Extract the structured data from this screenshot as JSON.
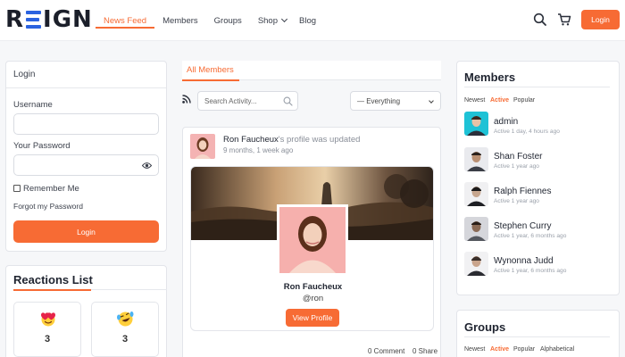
{
  "header": {
    "logo_left": "R",
    "logo_right": "IGN",
    "nav": [
      {
        "label": "News Feed"
      },
      {
        "label": "Members"
      },
      {
        "label": "Groups"
      },
      {
        "label": "Shop"
      },
      {
        "label": "Blog"
      }
    ],
    "login_label": "Login",
    "accent": "#f76b34",
    "logo_accent": "#2b63e0"
  },
  "login_widget": {
    "title": "Login",
    "username_label": "Username",
    "password_label": "Your Password",
    "remember_label": "Remember Me",
    "forgot_label": "Forgot my Password",
    "button_label": "Login"
  },
  "reactions": {
    "title": "Reactions List",
    "items": [
      {
        "icon": "heart-face-icon",
        "count": "3"
      },
      {
        "icon": "laughing-tears-icon",
        "count": "3"
      }
    ]
  },
  "feed": {
    "tab_label": "All Members",
    "search_placeholder": "Search Activity...",
    "filter_value": "— Everything",
    "activity": {
      "user": "Ron Faucheux",
      "action": "'s profile was updated",
      "time": "9 months, 1 week ago",
      "profile_name": "Ron Faucheux",
      "profile_handle": "@ron",
      "view_profile_label": "View Profile",
      "comments": "0 Comment",
      "shares": "0 Share"
    }
  },
  "members_widget": {
    "title": "Members",
    "filters": [
      "Newest",
      "Active",
      "Popular"
    ],
    "active_filter": "Active",
    "members": [
      {
        "name": "admin",
        "meta": "Active 1 day, 4 hours ago"
      },
      {
        "name": "Shan Foster",
        "meta": "Active 1 year ago"
      },
      {
        "name": "Ralph Fiennes",
        "meta": "Active 1 year ago"
      },
      {
        "name": "Stephen Curry",
        "meta": "Active 1 year, 6 months ago"
      },
      {
        "name": "Wynonna Judd",
        "meta": "Active 1 year, 6 months ago"
      }
    ]
  },
  "groups_widget": {
    "title": "Groups",
    "filters": [
      "Newest",
      "Active",
      "Popular",
      "Alphabetical"
    ],
    "active_filter": "Active"
  }
}
